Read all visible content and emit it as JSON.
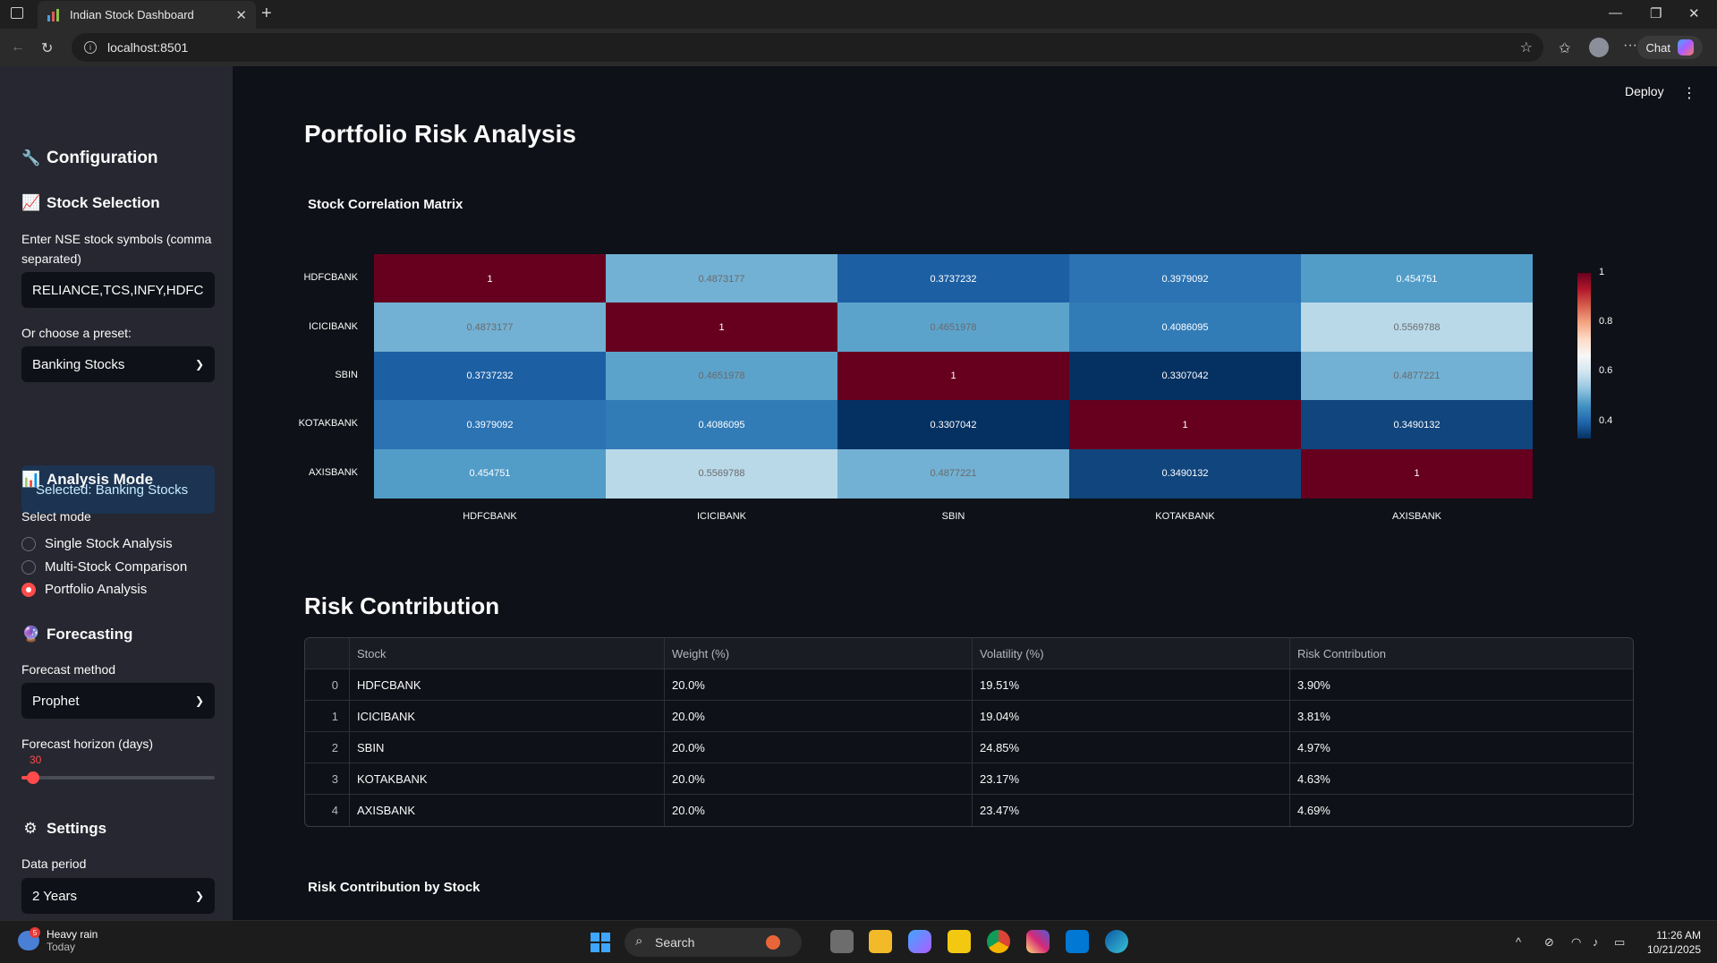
{
  "browser": {
    "tab_title": "Indian Stock Dashboard",
    "url": "localhost:8501",
    "chat_label": "Chat"
  },
  "header": {
    "deploy_label": "Deploy"
  },
  "sidebar": {
    "config_title": "Configuration",
    "stock_selection_title": "Stock Selection",
    "symbols_label": "Enter NSE stock symbols (comma separated)",
    "symbols_value": "RELIANCE,TCS,INFY,HDFC",
    "preset_label": "Or choose a preset:",
    "preset_value": "Banking Stocks",
    "selected_info": "Selected: Banking Stocks",
    "analysis_title": "Analysis Mode",
    "select_mode_label": "Select mode",
    "modes": [
      "Single Stock Analysis",
      "Multi-Stock Comparison",
      "Portfolio Analysis"
    ],
    "selected_mode_index": 2,
    "forecasting_title": "Forecasting",
    "forecast_method_label": "Forecast method",
    "forecast_method_value": "Prophet",
    "horizon_label": "Forecast horizon (days)",
    "horizon_value": "30",
    "horizon_fraction": 0.06,
    "settings_title": "Settings",
    "data_period_label": "Data period",
    "data_period_value": "2 Years"
  },
  "main": {
    "title": "Portfolio Risk Analysis",
    "correlation_title": "Stock Correlation Matrix",
    "risk_title": "Risk Contribution",
    "risk_chart_title": "Risk Contribution by Stock"
  },
  "chart_data": {
    "type": "heatmap",
    "title": "Stock Correlation Matrix",
    "categories": [
      "HDFCBANK",
      "ICICIBANK",
      "SBIN",
      "KOTAKBANK",
      "AXISBANK"
    ],
    "values": [
      [
        "1",
        "0.4873177",
        "0.3737232",
        "0.3979092",
        "0.454751"
      ],
      [
        "0.4873177",
        "1",
        "0.4651978",
        "0.4086095",
        "0.5569788"
      ],
      [
        "0.3737232",
        "0.4651978",
        "1",
        "0.3307042",
        "0.4877221"
      ],
      [
        "0.3979092",
        "0.4086095",
        "0.3307042",
        "1",
        "0.3490132"
      ],
      [
        "0.454751",
        "0.5569788",
        "0.4877221",
        "0.3490132",
        "1"
      ]
    ],
    "colorbar_ticks": [
      "1",
      "0.8",
      "0.6",
      "0.4"
    ],
    "colorscale": "RdBu reversed"
  },
  "risk_table": {
    "headers": [
      "Stock",
      "Weight (%)",
      "Volatility (%)",
      "Risk Contribution"
    ],
    "rows": [
      {
        "idx": "0",
        "stock": "HDFCBANK",
        "weight": "20.0%",
        "vol": "19.51%",
        "risk": "3.90%"
      },
      {
        "idx": "1",
        "stock": "ICICIBANK",
        "weight": "20.0%",
        "vol": "19.04%",
        "risk": "3.81%"
      },
      {
        "idx": "2",
        "stock": "SBIN",
        "weight": "20.0%",
        "vol": "24.85%",
        "risk": "4.97%"
      },
      {
        "idx": "3",
        "stock": "KOTAKBANK",
        "weight": "20.0%",
        "vol": "23.17%",
        "risk": "4.63%"
      },
      {
        "idx": "4",
        "stock": "AXISBANK",
        "weight": "20.0%",
        "vol": "23.47%",
        "risk": "4.69%"
      }
    ]
  },
  "taskbar": {
    "weather_text": "Heavy rain",
    "weather_sub": "Today",
    "weather_badge": "5",
    "search_label": "Search",
    "time": "11:26 AM",
    "date": "10/21/2025"
  }
}
